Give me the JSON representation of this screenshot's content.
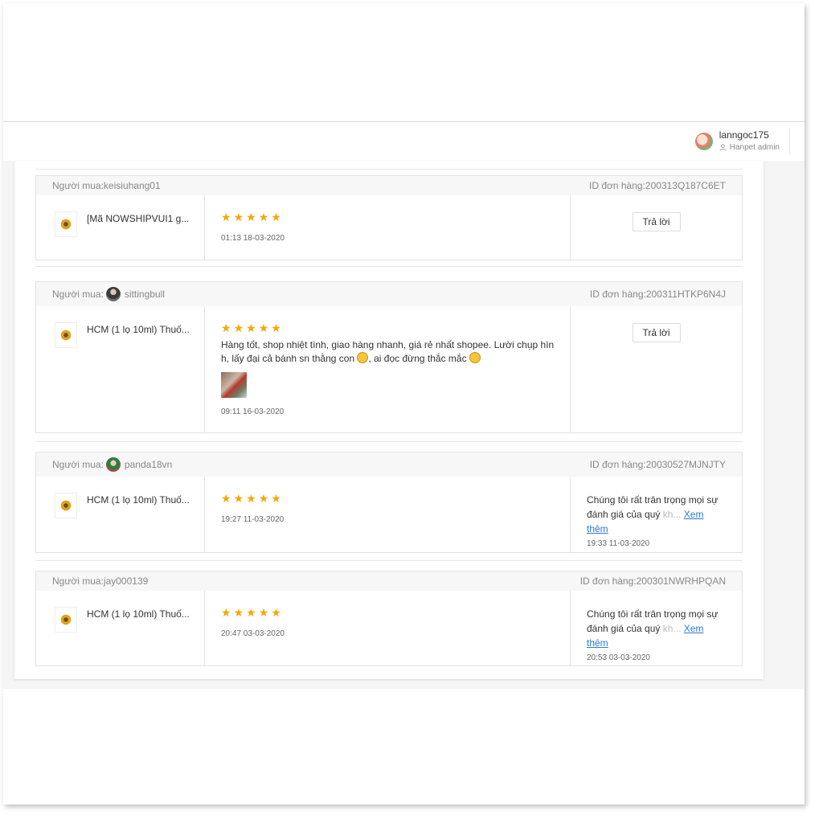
{
  "header": {
    "username": "lanngoc175",
    "role": "Hanpet admin"
  },
  "labels": {
    "buyer_prefix": "Người mua:",
    "order_prefix": "ID đơn hàng:",
    "reply_button": "Trả lời",
    "see_more": "Xem thêm"
  },
  "reviews": [
    {
      "buyer": "keisiuhang01",
      "order_id": "200313Q187C6ET",
      "product": "[Mã NOWSHIPVUI1 g...",
      "rating": 5,
      "text_1": "",
      "text_2": "",
      "text_3": "",
      "time": "01:13 18-03-2020",
      "reply": null
    },
    {
      "buyer": "sittingbull",
      "order_id": "200311HTKP6N4J",
      "product": "HCM (1 lọ 10ml) Thuố...",
      "rating": 5,
      "text_1": "Hàng tốt, shop nhiệt tình, giao hàng nhanh, giá rẻ nhất shopee. Lười chụp hìn",
      "text_2": "h, lấy đại cả bánh sn thằng con",
      "text_3": ", ai đọc đừng thắc mắc",
      "time": "09:11 16-03-2020",
      "reply": null
    },
    {
      "buyer": "panda18vn",
      "order_id": "20030527MJNJTY",
      "product": "HCM (1 lọ 10ml) Thuố...",
      "rating": 5,
      "time": "19:27 11-03-2020",
      "reply": {
        "line1": "Chúng tôi rất trân trọng mọi sự",
        "line2": "đánh giá của quý kh...",
        "time": "19:33 11-03-2020"
      }
    },
    {
      "buyer": "jay000139",
      "order_id": "200301NWRHPQAN",
      "product": "HCM (1 lọ 10ml) Thuố...",
      "rating": 5,
      "time": "20:47 03-03-2020",
      "reply": {
        "line1": "Chúng tôi rất trân trọng mọi sự",
        "line2": "đánh giá của quý kh...",
        "time": "20:53 03-03-2020"
      }
    }
  ],
  "colors": {
    "star": "#f6a700",
    "link": "#2b7ad6"
  }
}
